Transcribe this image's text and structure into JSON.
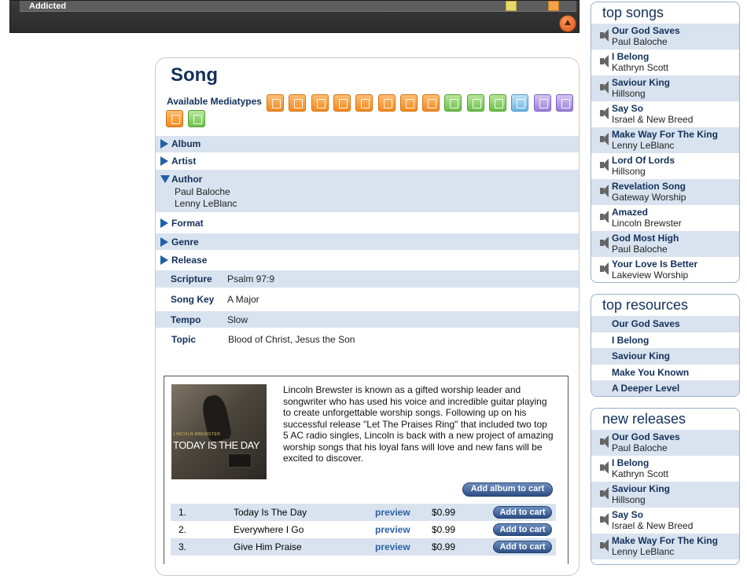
{
  "player": {
    "track_title": "Addicted"
  },
  "song": {
    "heading": "Song",
    "mediatypes_label": "Available Mediatypes",
    "mediatypes": [
      "audio",
      "audio",
      "audio",
      "audio",
      "audio",
      "audio",
      "audio",
      "audio",
      "sheet",
      "sheet",
      "sheet",
      "video",
      "person",
      "person",
      "audio",
      "sheet"
    ],
    "sections": {
      "album": "Album",
      "artist": "Artist",
      "author": "Author",
      "authors": [
        "Paul Baloche",
        "Lenny LeBlanc"
      ],
      "format": "Format",
      "genre": "Genre",
      "release": "Release"
    },
    "fields": {
      "scripture_label": "Scripture",
      "scripture": "Psalm 97:9",
      "key_label": "Song Key",
      "key": "A Major",
      "tempo_label": "Tempo",
      "tempo": "Slow",
      "topic_label": "Topic",
      "topic": "Blood of Christ, Jesus the Son"
    }
  },
  "album": {
    "cover_title": "TODAY IS THE DAY",
    "cover_artist": "LINCOLN BREWSTER",
    "description": "Lincoln Brewster is known as a gifted worship leader and songwriter who has used his voice and incredible guitar playing to create unforgettable worship songs. Following up on his successful release \"Let The Praises Ring\" that included two top 5 AC radio singles, Lincoln is back with a new project of amazing worship songs that his loyal fans will love and new fans will be excited to discover.",
    "add_album_label": "Add album to cart",
    "preview_label": "preview",
    "add_label": "Add to cart",
    "tracks": [
      {
        "num": "1.",
        "title": "Today Is The Day",
        "price": "$0.99"
      },
      {
        "num": "2.",
        "title": "Everywhere I Go",
        "price": "$0.99"
      },
      {
        "num": "3.",
        "title": "Give Him Praise",
        "price": "$0.99"
      }
    ]
  },
  "top_songs": {
    "heading": "top songs",
    "items": [
      {
        "title": "Our God Saves",
        "artist": "Paul Baloche"
      },
      {
        "title": "I Belong",
        "artist": "Kathryn Scott"
      },
      {
        "title": "Saviour King",
        "artist": "Hillsong"
      },
      {
        "title": "Say So",
        "artist": "Israel & New Breed"
      },
      {
        "title": "Make Way For The King",
        "artist": "Lenny LeBlanc"
      },
      {
        "title": "Lord Of Lords",
        "artist": "Hillsong"
      },
      {
        "title": "Revelation Song",
        "artist": "Gateway Worship"
      },
      {
        "title": "Amazed",
        "artist": "Lincoln Brewster"
      },
      {
        "title": "God Most High",
        "artist": "Paul Baloche"
      },
      {
        "title": "Your Love Is Better",
        "artist": "Lakeview Worship"
      }
    ]
  },
  "top_resources": {
    "heading": "top resources",
    "items": [
      "Our God Saves",
      "I Belong",
      "Saviour King",
      "Make You Known",
      "A Deeper Level"
    ]
  },
  "new_releases": {
    "heading": "new releases",
    "items": [
      {
        "title": "Our God Saves",
        "artist": "Paul Baloche"
      },
      {
        "title": "I Belong",
        "artist": "Kathryn Scott"
      },
      {
        "title": "Saviour King",
        "artist": "Hillsong"
      },
      {
        "title": "Say So",
        "artist": "Israel & New Breed"
      },
      {
        "title": "Make Way For The King",
        "artist": "Lenny LeBlanc"
      }
    ]
  }
}
